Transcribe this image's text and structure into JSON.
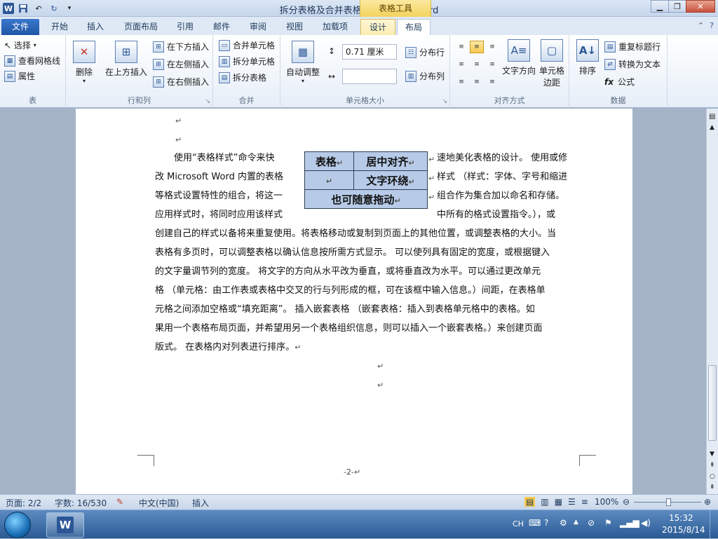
{
  "window": {
    "title": "拆分表格及合并表格 - Microsoft Word",
    "context_tab_group": "表格工具"
  },
  "tabs": [
    {
      "label": "文件"
    },
    {
      "label": "开始"
    },
    {
      "label": "插入"
    },
    {
      "label": "页面布局"
    },
    {
      "label": "引用"
    },
    {
      "label": "邮件"
    },
    {
      "label": "审阅"
    },
    {
      "label": "视图"
    },
    {
      "label": "加载项"
    },
    {
      "label": "设计"
    },
    {
      "label": "布局"
    }
  ],
  "ribbon": {
    "groups": {
      "table": "表",
      "rows_cols": "行和列",
      "merge": "合并",
      "cell_size": "单元格大小",
      "alignment": "对齐方式",
      "data": "数据"
    },
    "table": {
      "select": "选择",
      "gridlines": "查看网格线",
      "properties": "属性"
    },
    "rows_cols": {
      "delete": "删除",
      "insert_above": "在上方插入",
      "insert_below": "在下方插入",
      "insert_left": "在左侧插入",
      "insert_right": "在右侧插入"
    },
    "merge": {
      "merge_cells": "合并单元格",
      "split_cells": "拆分单元格",
      "split_table": "拆分表格"
    },
    "cell_size": {
      "autofit": "自动调整",
      "height_value": "0.71 厘米",
      "distribute_rows": "分布行",
      "distribute_cols": "分布列"
    },
    "alignment": {
      "text_direction": "文字方向",
      "cell_margins_1": "单元格",
      "cell_margins_2": "边距"
    },
    "data": {
      "sort": "排序",
      "repeat_header": "重复标题行",
      "convert_text": "转换为文本",
      "formula": "公式"
    }
  },
  "document": {
    "paragraph_lines": [
      "使用“表格样式”命令来快",
      "改 Microsoft Word 内置的表格",
      "等格式设置特性的组合，将这一",
      "应用样式时，将同时应用该样式",
      "创建自己的样式以备将来重复使用。将表格移动或复制到页面上的其他位置，或调整表格的大小。当",
      "表格有多页时，可以调整表格以确认信息按所需方式显示。 可以使列具有固定的宽度，或根据键入",
      "的文字量调节列的宽度。   将文字的方向从水平改为垂直，或将垂直改为水平。可以通过更改单元",
      "格 （单元格：由工作表或表格中交叉的行与列形成的框，可在该框中输入信息。）间距，在表格单",
      "元格之间添加空格或“填充距离”。 插入嵌套表格 （嵌套表格：插入到表格单元格中的表格。如",
      "果用一个表格布局页面，并希望用另一个表格组织信息，则可以插入一个嵌套表格。）来创建页面",
      "版式。 在表格内对列表进行排序。"
    ],
    "right_lines": [
      "速地美化表格的设计。 使用或修",
      "样式 （样式：字体、字号和缩进",
      "组合作为集合加以命名和存储。",
      "中所有的格式设置指令。），或"
    ],
    "table_cells": {
      "r1c1": "表格",
      "r1c2": "居中对齐",
      "r2c1": "",
      "r2c2": "文字环绕",
      "r3": "也可随意拖动"
    },
    "page_number": "-2-"
  },
  "status": {
    "page": "页面: 2/2",
    "words": "字数: 16/530",
    "language": "中文(中国)",
    "mode": "插入",
    "zoom": "100%"
  },
  "taskbar": {
    "ime": "CH",
    "time": "15:32",
    "date": "2015/8/14"
  }
}
